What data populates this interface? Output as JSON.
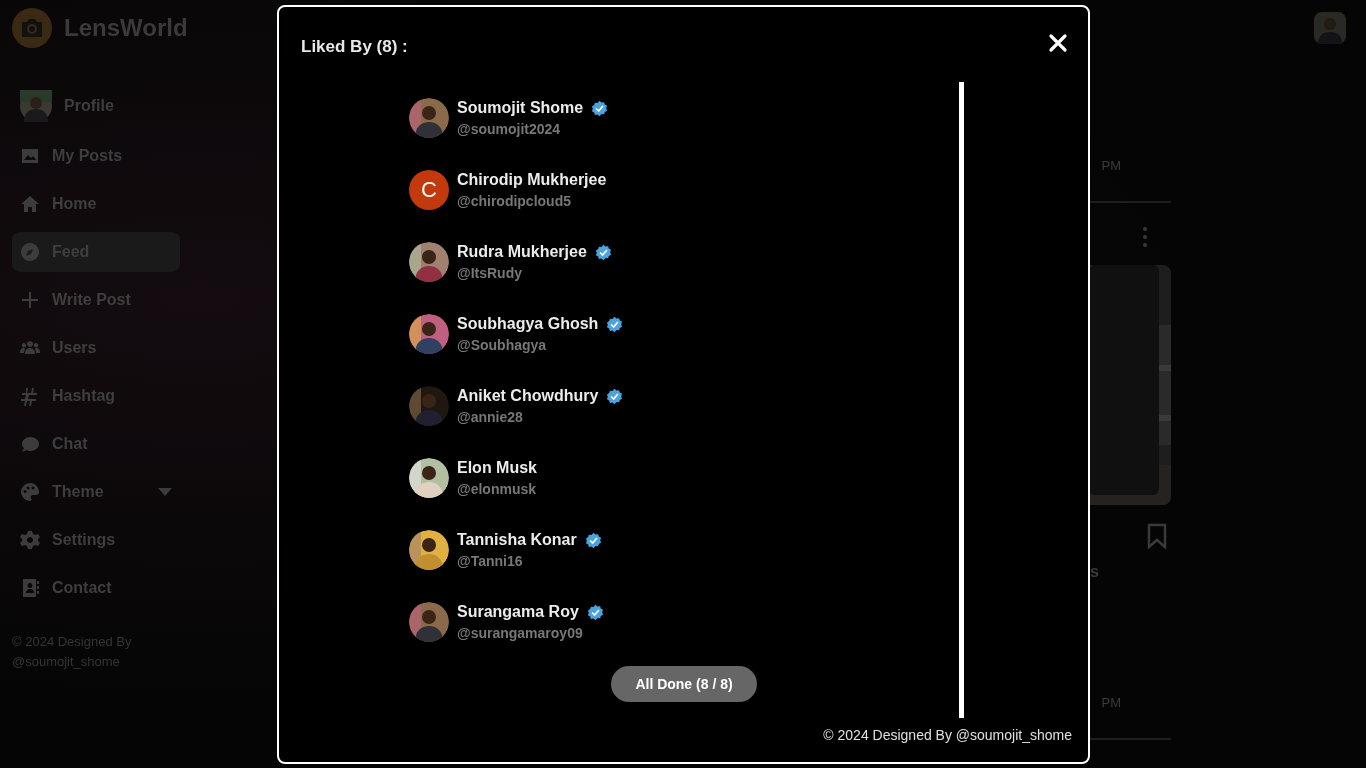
{
  "app": {
    "logo_text": "LensWorld"
  },
  "sidebar": {
    "items": [
      {
        "kind": "profile",
        "label": "Profile",
        "selected": false
      },
      {
        "kind": "link",
        "label": "My Posts",
        "selected": false
      },
      {
        "kind": "link",
        "label": "Home",
        "selected": false
      },
      {
        "kind": "link",
        "label": "Feed",
        "selected": true
      },
      {
        "kind": "link",
        "label": "Write Post",
        "selected": false
      },
      {
        "kind": "link",
        "label": "Users",
        "selected": false
      },
      {
        "kind": "link",
        "label": "Hashtag",
        "selected": false
      },
      {
        "kind": "link",
        "label": "Chat",
        "selected": false
      },
      {
        "kind": "dropdown",
        "label": "Theme",
        "selected": false
      },
      {
        "kind": "link",
        "label": "Settings",
        "selected": false
      },
      {
        "kind": "link",
        "label": "Contact",
        "selected": false
      }
    ],
    "footer": "© 2024 Designed By @soumojit_shome"
  },
  "feed": {
    "time_1": "PM",
    "caption_fragment": "s",
    "time_2": "PM"
  },
  "modal": {
    "title": "Liked By (8) :",
    "users": [
      {
        "name": "Soumojit Shome",
        "handle": "@soumojit2024",
        "verified": true
      },
      {
        "kind": "initial",
        "initial": "C",
        "name": "Chirodip Mukherjee",
        "handle": "@chirodipcloud5",
        "verified": false
      },
      {
        "name": "Rudra Mukherjee",
        "handle": "@ItsRudy",
        "verified": true
      },
      {
        "name": "Soubhagya Ghosh",
        "handle": "@Soubhagya",
        "verified": true
      },
      {
        "name": "Aniket Chowdhury",
        "handle": "@annie28",
        "verified": true
      },
      {
        "name": "Elon Musk",
        "handle": "@elonmusk",
        "verified": false
      },
      {
        "name": "Tannisha Konar",
        "handle": "@Tanni16",
        "verified": true
      },
      {
        "name": "Surangama Roy",
        "handle": "@surangamaroy09",
        "verified": true
      }
    ],
    "done_button": "All Done (8 / 8)",
    "footer": "© 2024 Designed By @soumojit_shome"
  }
}
